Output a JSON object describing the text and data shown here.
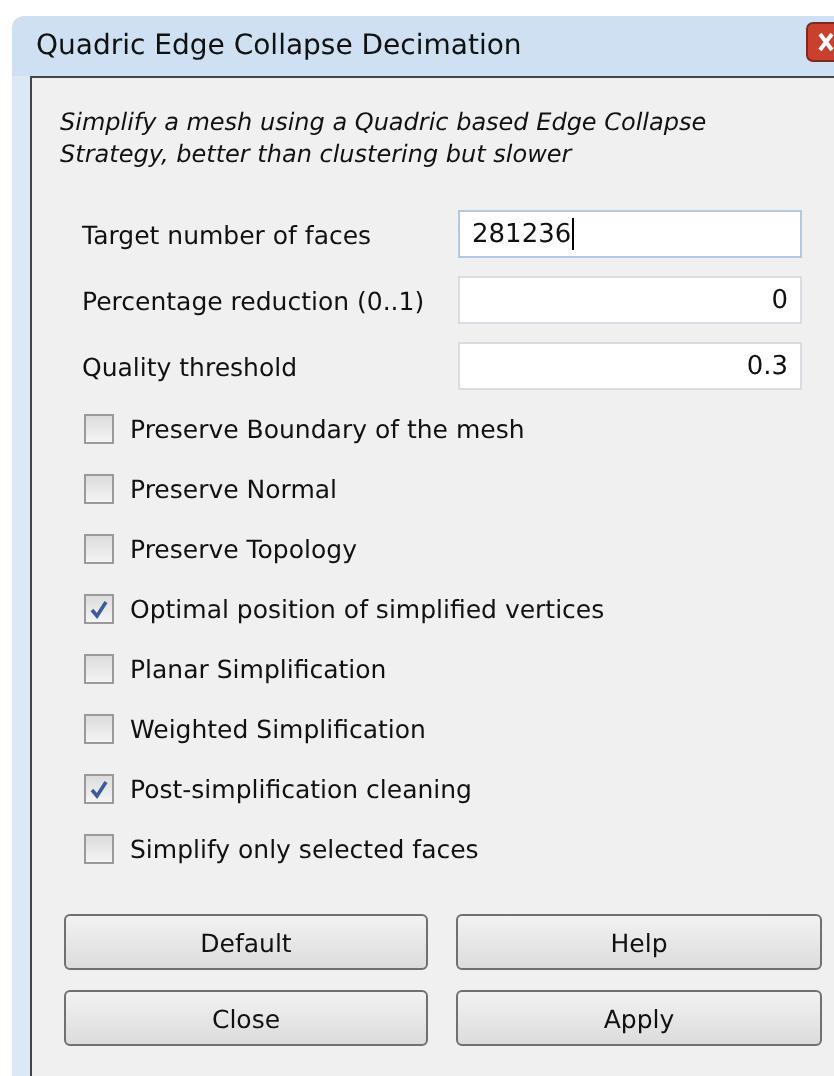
{
  "window": {
    "title": "Quadric Edge Collapse Decimation"
  },
  "description": "Simplify a mesh using a Quadric based Edge Collapse Strategy, better than clustering but slower",
  "fields": [
    {
      "label": "Target number of faces",
      "value": "281236",
      "focused": true
    },
    {
      "label": "Percentage reduction (0..1)",
      "value": "0",
      "focused": false
    },
    {
      "label": "Quality threshold",
      "value": "0.3",
      "focused": false
    }
  ],
  "options": [
    {
      "label": "Preserve Boundary of the mesh",
      "checked": false
    },
    {
      "label": "Preserve Normal",
      "checked": false
    },
    {
      "label": "Preserve Topology",
      "checked": false
    },
    {
      "label": "Optimal position of simplified vertices",
      "checked": true
    },
    {
      "label": "Planar Simplification",
      "checked": false
    },
    {
      "label": "Weighted Simplification",
      "checked": false
    },
    {
      "label": "Post-simplification cleaning",
      "checked": true
    },
    {
      "label": "Simplify only selected faces",
      "checked": false
    }
  ],
  "buttons": [
    "Default",
    "Help",
    "Close",
    "Apply"
  ]
}
